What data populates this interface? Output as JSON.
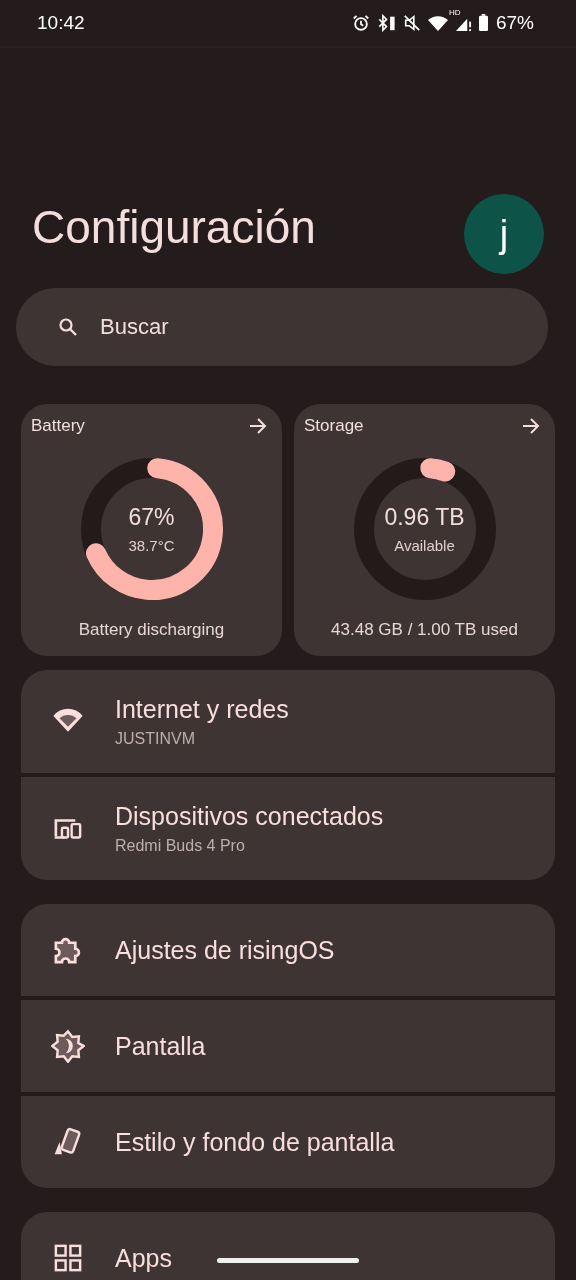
{
  "status_bar": {
    "time": "10:42",
    "network_badge": "HD",
    "battery_percent": "67%"
  },
  "header": {
    "title": "Configuración",
    "avatar_letter": "j"
  },
  "search": {
    "placeholder": "Buscar"
  },
  "cards": [
    {
      "title": "Battery",
      "value": "67%",
      "sublabel": "38.7°C",
      "caption": "Battery discharging",
      "level": 0.67
    },
    {
      "title": "Storage",
      "value": "0.96 TB",
      "sublabel": "Available",
      "caption": "43.48 GB / 1.00 TB used",
      "level": 0.04
    }
  ],
  "groups": [
    {
      "items": [
        {
          "title": "Internet y redes",
          "subtitle": "JUSTINVM"
        },
        {
          "title": "Dispositivos conectados",
          "subtitle": "Redmi Buds 4 Pro"
        }
      ]
    },
    {
      "items": [
        {
          "title": "Ajustes de risingOS"
        },
        {
          "title": "Pantalla"
        },
        {
          "title": "Estilo y fondo de pantalla"
        }
      ]
    },
    {
      "items": [
        {
          "title": "Apps"
        }
      ]
    }
  ]
}
